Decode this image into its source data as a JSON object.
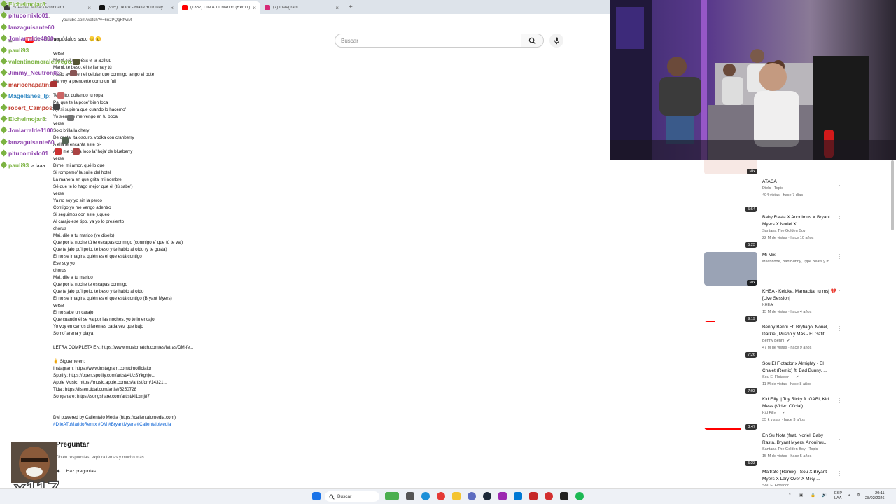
{
  "browser": {
    "tabs": [
      {
        "label": "Streamer Music Dashboard",
        "color": "#3a3a3a",
        "active": false
      },
      {
        "label": "(99+) TikTok - Make Your Day",
        "color": "#111111",
        "active": false
      },
      {
        "label": "(1352) Dile A Tu Marido (Remix)",
        "color": "#ff0000",
        "active": true
      },
      {
        "label": "(7) Instagram",
        "color": "#d62976",
        "active": false
      }
    ],
    "new_tab": "+",
    "address": "youtube.com/watch?v=6n2PQgRfwiM"
  },
  "youtube": {
    "logo": "YouTube",
    "search_placeholder": "Buscar"
  },
  "description": {
    "lines": [
      "verse",
      "Mami, sé que ésa e' la actitud",
      "Mami, te beso, él te llama y tú",
      "Modo avión en el celular que conmigo tengo el bote",
      "Me voy a prenderte como un full",
      "",
      "Te quito, quitando tu ropa",
      "Pa' que te la pose' bien loca",
      "Ay, si supiera que cuando lo hacemo'",
      "Yo siempre me vengo en tu boca",
      "verse",
      "Solo brilla la chery",
      "De cristal 'ta oscuro, vodka con cranberry",
      "A ella le encanta este bi-",
      "A mí me ponía loco la' hoja' de blueberry",
      "verse",
      "Dime, mi amor, qué lo que",
      "Si rompemo' la suite del hotel",
      "La manera en que grita' mi nombre",
      "Sé que te lo hago mejor que él (tú sabe')",
      "verse",
      "Ya no soy yo sin la perco",
      "Contigo yo me vengo adentro",
      "Si seguimos con este juqueo",
      "Al carajo ese tipo, ya yo lo presiento",
      "chorus",
      "Mai, dile a tu marido (ve diselo)",
      "Que por la noche tú te escapas conmigo (conmigo e' que tú te va')",
      "Que te jalo po'l pelo, te beso y te hablo al oído (y te gusta)",
      "Él no se imagina quién es el que está contigo",
      "Ese soy yo",
      "chorus",
      "Mai, dile a tu marido",
      "Que por la noche te escapas conmigo",
      "Que te jalo po'l pelo, te beso y te hablo al oído",
      "Él no se imagina quién es el que está contigo (Bryant Myers)",
      "verse",
      "Él no sabe un carajo",
      "Que cuando él se va por las noches, yo te lo encajo",
      "Yo voy en carros diferentes cada vez que bajo",
      "Somo' arena y playa",
      "",
      "LETRA COMPLETA EN: https://www.musixmatch.com/es/letras/DM-fe...",
      "",
      "✌️ Sígueme en:",
      "Instagram: https://www.instagram.com/dmofficialpr",
      "Spotify: https://open.spotify.com/artist/4UzSYkghje...",
      "Apple Music: https://music.apple.com/us/artist/dm/14321...",
      "Tidal: https://listen.tidal.com/artist/5250728",
      "Songshare: https://songshare.com/artist/kl1xmj87",
      "",
      "",
      "DM powered by Calientalo Media (https://calientalomedia.com)"
    ],
    "hashtags": "#DileATuMaridoRemix #DM #BryantMyers #CalientaloMedia"
  },
  "ask": {
    "title": "Preguntar",
    "subtitle": "Obtén respuestas, explora temas y mucho más",
    "button": "Haz preguntas"
  },
  "chat": {
    "messages": [
      {
        "user": "Elcheimojar8",
        "text": ":",
        "color": "#7cb342"
      },
      {
        "user": "pitucomixlo01",
        "text": ":",
        "color": "#8e44ad"
      },
      {
        "user": "lanzaguisante60",
        "text": ":",
        "color": "#8e44ad"
      },
      {
        "user": "Jonlarralde4800",
        "text": ": apúdalos sacc 😊😠",
        "color": "#8e44ad"
      },
      {
        "user": "pauli93",
        "text": ":",
        "color": "#7cb342"
      },
      {
        "user": "valentinomoralesvego",
        "text": ":",
        "color": "#7cb342"
      },
      {
        "user": "Jimmy_Neutron03",
        "text": ":",
        "color": "#8e44ad"
      },
      {
        "user": "mariochapatin",
        "text": ":",
        "color": "#c0392b"
      },
      {
        "user": "Magellanes_lp",
        "text": ":",
        "color": "#2e86c1"
      },
      {
        "user": "robert_Campos",
        "text": ":",
        "color": "#c0392b"
      },
      {
        "user": "Elcheimojar8",
        "text": ":",
        "color": "#7cb342"
      },
      {
        "user": "Jonlarralde1100",
        "text": ":",
        "color": "#8e44ad"
      },
      {
        "user": "lanzaguisante60",
        "text": ":",
        "color": "#8e44ad"
      },
      {
        "user": "pitucomixlo01",
        "text": ":",
        "color": "#8e44ad"
      },
      {
        "user": "pauli93",
        "text": ": a laaa",
        "color": "#7cb342"
      }
    ]
  },
  "recommendations": [
    {
      "title": "",
      "channel": "",
      "meta": "",
      "duration": "Mix",
      "verified": false,
      "thumb": "red",
      "progress": 0
    },
    {
      "title": "ATACA",
      "channel": "Dielc · Topic",
      "meta": "404 vistas · hace 7 días",
      "duration": "5:54",
      "verified": false,
      "thumb": "white",
      "progress": 0
    },
    {
      "title": "Baby Rasta X Anonimus X Bryant Myers X Noriel X ...",
      "channel": "Santana The Golden Boy",
      "meta": "22 M de vistas · hace 10 años",
      "duration": "5:23",
      "verified": false,
      "thumb": "white",
      "progress": 0
    },
    {
      "title": "Mi Mix",
      "channel": "Macbridde, Bad Bunny, Type Beats y m...",
      "meta": "",
      "duration": "Mix",
      "verified": false,
      "thumb": "grey",
      "progress": 0
    },
    {
      "title": "KHEA - Keloke, Mamacita, tu msj 💔 [Live Session]",
      "channel": "KHEA",
      "meta": "15 M de vistas · hace 4 años",
      "duration": "9:19",
      "verified": true,
      "thumb": "white",
      "progress": 0.2
    },
    {
      "title": "Benny Benni Ft. Brytiago, Noriel, Darkiel, Pusho y Más - El Gatit...",
      "channel": "Benny Benni",
      "meta": "47 M de vistas · hace 9 años",
      "duration": "7:26",
      "verified": true,
      "thumb": "white",
      "progress": 0
    },
    {
      "title": "Sou El Flotador x Almighty - El Chalet (Remix) ft. Bad Bunny, ...",
      "channel": "Sou El Flotador",
      "meta": "11 M de vistas · hace 8 años",
      "duration": "7:03",
      "verified": true,
      "thumb": "white",
      "progress": 0
    },
    {
      "title": "Kid Filly || Toy Ricky ft. GABI, Kid Mess (Video Oficial)",
      "channel": "Kid Filly",
      "meta": "35 k vistas · hace 3 años",
      "duration": "3:47",
      "verified": true,
      "thumb": "white",
      "progress": 0.7
    },
    {
      "title": "En Su Nota (feat. Noriel, Baby Rasta, Bryant Myers, Anonimu...",
      "channel": "Santana The Golden Boy - Topic",
      "meta": "15 M de vistas · hace 5 años",
      "duration": "5:23",
      "verified": false,
      "thumb": "white",
      "progress": 0
    },
    {
      "title": "Maltrato (Remix) - Sou X Bryant Myers X Lary Over X Miky ...",
      "channel": "Sou El Flotador",
      "meta": "",
      "duration": "",
      "verified": false,
      "thumb": "white",
      "progress": 0
    }
  ],
  "reaction": {
    "count": "x117"
  },
  "taskbar": {
    "search": "Buscar",
    "lang": "ESP\nLAA",
    "time": "20:11",
    "date": "28/02/2026"
  }
}
